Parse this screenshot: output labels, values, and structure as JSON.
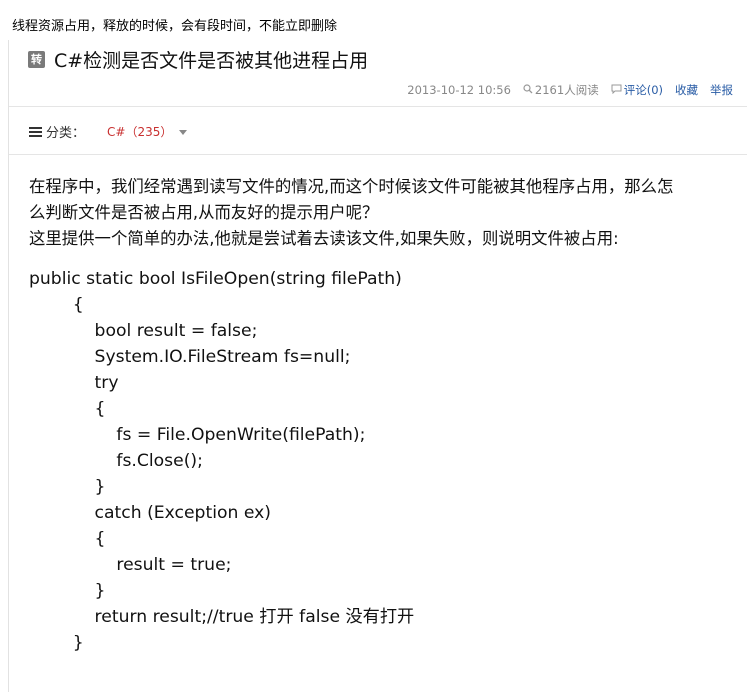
{
  "top_note": "线程资源占用，释放的时候，会有段时间，不能立即删除",
  "article": {
    "badge": "转",
    "title": "C#检测是否文件是否被其他进程占用",
    "meta": {
      "date": "2013-10-12 10:56",
      "reads": "2161人阅读",
      "comments": "评论(0)",
      "favorite": "收藏",
      "report": "举报"
    },
    "category": {
      "label": "分类：",
      "value": "C#（235）"
    },
    "paragraphs": [
      "在程序中，我们经常遇到读写文件的情况,而这个时候该文件可能被其他程序占用，那么怎",
      "么判断文件是否被占用,从而友好的提示用户呢？",
      "这里提供一个简单的办法,他就是尝试着去读该文件,如果失败，则说明文件被占用:"
    ],
    "code_lines": [
      "public static bool IsFileOpen(string filePath)",
      "        {",
      "            bool result = false;",
      "            System.IO.FileStream fs=null;",
      "            try",
      "            {",
      "                fs = File.OpenWrite(filePath);",
      "                fs.Close();",
      "            }",
      "            catch (Exception ex)",
      "            {",
      "                result = true;",
      "            }",
      "            return result;//true 打开 false 没有打开",
      "        }"
    ]
  },
  "icons": {
    "reads": "eye-icon",
    "comments": "comment-icon",
    "category": "list-icon",
    "dropdown": "caret-down-icon"
  },
  "colors": {
    "link": "#2a5da6",
    "category": "#c83030",
    "meta": "#888888"
  }
}
